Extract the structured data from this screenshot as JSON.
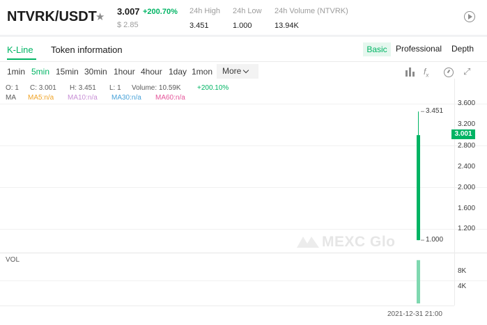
{
  "header": {
    "pair": "NTVRK/USDT",
    "price": "3.007",
    "change": "+200.70%",
    "usd_price": "$ 2.85",
    "stats": [
      {
        "label": "24h High",
        "value": "3.451"
      },
      {
        "label": "24h Low",
        "value": "1.000"
      },
      {
        "label": "24h Volume (NTVRK)",
        "value": "13.94K"
      }
    ],
    "icons": {
      "star": "star-icon",
      "play": "play-circle-icon"
    }
  },
  "tabs": {
    "kline": "K-Line",
    "token": "Token information"
  },
  "views": {
    "basic": "Basic",
    "professional": "Professional",
    "depth": "Depth"
  },
  "intervals": [
    "1min",
    "5min",
    "15min",
    "30min",
    "1hour",
    "4hour",
    "1day",
    "1mon"
  ],
  "active_interval": "5min",
  "more_label": "More",
  "tool_icons": [
    "candlestick-icon",
    "fx-indicator-icon",
    "gauge-icon",
    "fullscreen-icon"
  ],
  "ohlc": {
    "open": "O: 1",
    "close": "C: 3.001",
    "high": "H: 3.451",
    "low": "L: 1",
    "volume": "Volume: 10.59K",
    "change": "+200.10%"
  },
  "ma": {
    "label": "MA",
    "ma5": "MA5:n/a",
    "ma10": "MA10:n/a",
    "ma30": "MA30:n/a",
    "ma60": "MA60:n/a"
  },
  "colors": {
    "up": "#00b464",
    "ma5": "#f0a428",
    "ma10": "#c88fd6",
    "ma30": "#4aa3d9",
    "ma60": "#e5559a"
  },
  "price_axis": [
    "3.600",
    "3.200",
    "2.800",
    "2.400",
    "2.000",
    "1.600",
    "1.200"
  ],
  "current_price_tag": "3.001",
  "high_marker": "3.451",
  "low_marker": "1.000",
  "volume_axis": [
    "8K",
    "4K"
  ],
  "volume_label": "VOL",
  "time_label": "2021-12-31 21:00",
  "watermark": "MEXC Glo",
  "candle": {
    "open": 1.0,
    "close": 3.001,
    "high": 3.451,
    "low": 1.0,
    "volume": 10590
  }
}
